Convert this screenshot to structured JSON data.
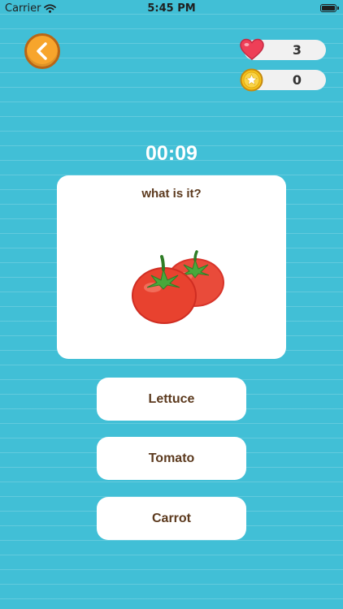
{
  "status_bar": {
    "carrier": "Carrier",
    "time": "5:45 PM",
    "icons": [
      "wifi-icon",
      "battery-icon"
    ]
  },
  "header": {
    "back_icon": "chevron-left-icon",
    "lives": {
      "icon": "heart-icon",
      "value": "3"
    },
    "coins": {
      "icon": "star-coin-icon",
      "value": "0"
    }
  },
  "timer": "00:09",
  "question": {
    "prompt": "what is it?",
    "image_icon": "tomato-image"
  },
  "answers": [
    {
      "label": "Lettuce"
    },
    {
      "label": "Tomato"
    },
    {
      "label": "Carrot"
    }
  ],
  "colors": {
    "background": "#41bfd6",
    "card": "#ffffff",
    "text_brown": "#5c3a1e",
    "accent_orange": "#f7a52c",
    "heart_red": "#ee3f57",
    "coin_gold": "#f6c219"
  }
}
